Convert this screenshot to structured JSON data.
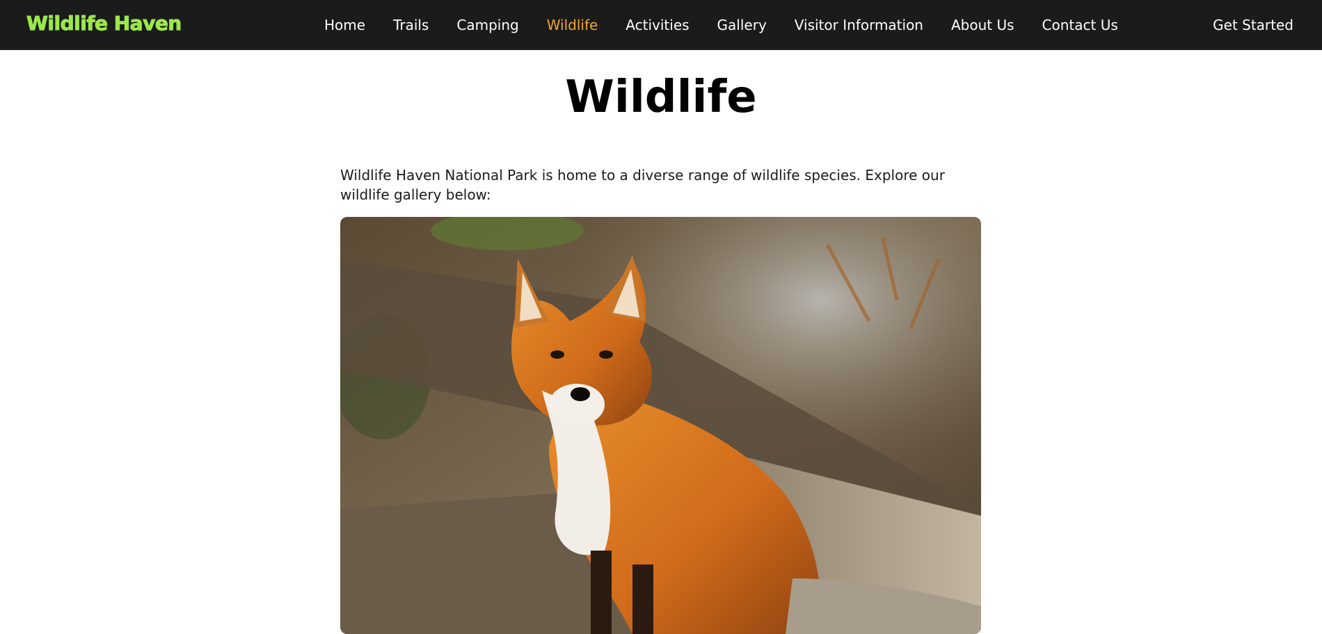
{
  "header": {
    "logo_text": "Wildlife Haven",
    "nav": [
      {
        "label": "Home",
        "active": false
      },
      {
        "label": "Trails",
        "active": false
      },
      {
        "label": "Camping",
        "active": false
      },
      {
        "label": "Wildlife",
        "active": true
      },
      {
        "label": "Activities",
        "active": false
      },
      {
        "label": "Gallery",
        "active": false
      },
      {
        "label": "Visitor Information",
        "active": false
      },
      {
        "label": "About Us",
        "active": false
      },
      {
        "label": "Contact Us",
        "active": false
      }
    ],
    "cta_label": "Get Started"
  },
  "main": {
    "title": "Wildlife",
    "intro": "Wildlife Haven National Park is home to a diverse range of wildlife species. Explore our wildlife gallery below:",
    "photo_subject": "red-fox-photo"
  },
  "colors": {
    "header_bg": "#1b1b1b",
    "logo": "#9be84a",
    "nav_active": "#f0a531",
    "nav_text": "#ffffff"
  }
}
